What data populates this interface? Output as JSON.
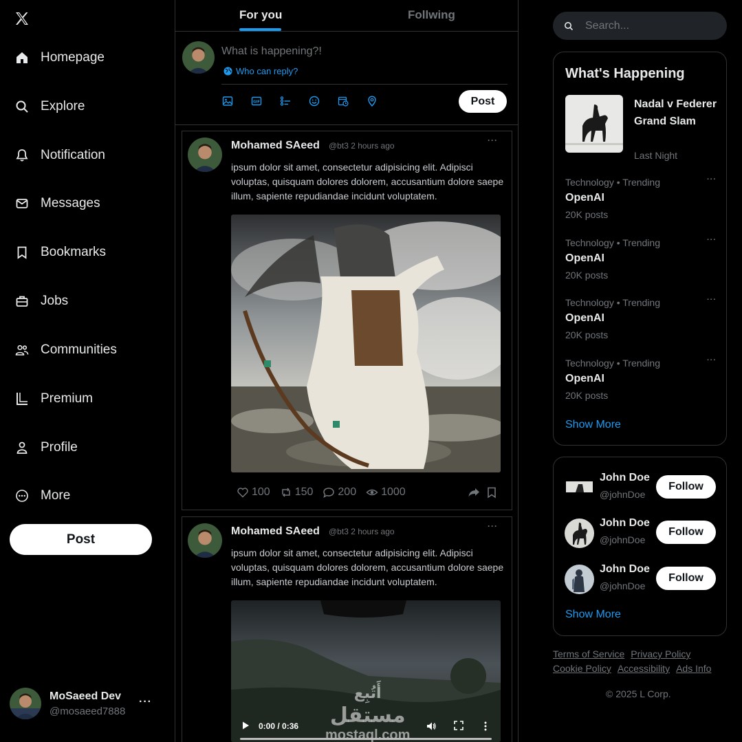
{
  "app": {
    "logo": "x-logo-icon"
  },
  "nav": {
    "items": [
      {
        "label": "Homepage",
        "icon": "home-icon"
      },
      {
        "label": "Explore",
        "icon": "search-icon"
      },
      {
        "label": "Notification",
        "icon": "bell-icon"
      },
      {
        "label": "Messages",
        "icon": "mail-icon"
      },
      {
        "label": "Bookmarks",
        "icon": "bookmark-icon"
      },
      {
        "label": "Jobs",
        "icon": "briefcase-icon"
      },
      {
        "label": "Communities",
        "icon": "people-icon"
      },
      {
        "label": "Premium",
        "icon": "premium-icon"
      },
      {
        "label": "Profile",
        "icon": "user-icon"
      },
      {
        "label": "More",
        "icon": "more-circle-icon"
      }
    ],
    "post_label": "Post"
  },
  "account": {
    "name": "MoSaeed Dev",
    "handle": "@mosaeed7888",
    "menu": "···"
  },
  "tabs": {
    "active": "For you",
    "inactive": "Follwing"
  },
  "composer": {
    "placeholder": "What is happening?!",
    "reply_label": "Who can reply?",
    "tools": [
      "image-icon",
      "gif-icon",
      "poll-icon",
      "emoji-icon",
      "schedule-icon",
      "location-icon"
    ],
    "post_label": "Post"
  },
  "tweets": [
    {
      "author": "Mohamed SAeed",
      "meta": "@bt3 2 hours ago",
      "more": "···",
      "text": "ipsum dolor sit amet, consectetur adipisicing elit. Adipisci voluptas, quisquam dolores dolorem, accusantium dolore saepe illum, sapiente repudiandae incidunt voluptatem.",
      "likes": "100",
      "reposts": "150",
      "replies": "200",
      "views": "1000"
    },
    {
      "author": "Mohamed SAeed",
      "meta": "@bt3 2 hours ago",
      "more": "···",
      "text": "ipsum dolor sit amet, consectetur adipisicing elit. Adipisci voluptas, quisquam dolores dolorem, accusantium dolore saepe illum, sapiente repudiandae incidunt voluptatem.",
      "video": {
        "time": "0:00 / 0:36",
        "progress": 0
      },
      "watermark": {
        "arabic": "مستقل",
        "latin": "mostaql.com",
        "caption": "أَتُبِع"
      }
    }
  ],
  "search": {
    "placeholder": "Search..."
  },
  "happening": {
    "title": "What's Happening",
    "featured": {
      "title": "Nadal v Federer Grand Slam",
      "sub": "Last Night"
    },
    "trends": [
      {
        "cat": "Technology • Trending",
        "name": "OpenAI",
        "count": "20K posts"
      },
      {
        "cat": "Technology • Trending",
        "name": "OpenAI",
        "count": "20K posts"
      },
      {
        "cat": "Technology • Trending",
        "name": "OpenAI",
        "count": "20K posts"
      },
      {
        "cat": "Technology • Trending",
        "name": "OpenAI",
        "count": "20K posts"
      }
    ],
    "trend_menu": "···",
    "show_more": "Show More"
  },
  "who_to_follow": {
    "users": [
      {
        "name": "John Doe",
        "handle": "@johnDoe",
        "button": "Follow"
      },
      {
        "name": "John Doe",
        "handle": "@johnDoe",
        "button": "Follow"
      },
      {
        "name": "John Doe",
        "handle": "@johnDoe",
        "button": "Follow"
      }
    ],
    "show_more": "Show More"
  },
  "footer": {
    "links": [
      "Terms of Service",
      "Privacy Policy",
      "Cookie Policy",
      "Accessibility",
      "Ads Info"
    ],
    "copyright": "© 2025 L Corp."
  },
  "colors": {
    "accent": "#1d9bf0",
    "background": "#000000",
    "border": "#2f3336",
    "muted": "#71767b"
  }
}
